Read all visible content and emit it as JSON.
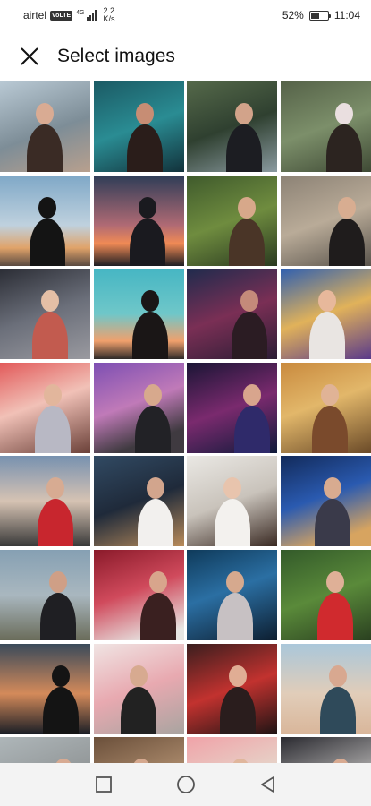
{
  "status_bar": {
    "carrier": "airtel",
    "volte": "VoLTE",
    "network": "4G",
    "speed_value": "2.2",
    "speed_unit": "K/s",
    "battery_text": "52%",
    "battery_level": 0.52,
    "time": "11:04"
  },
  "header": {
    "close_icon": "close-icon",
    "title": "Select images"
  },
  "gallery": {
    "images": [
      {
        "bg": "linear-gradient(160deg,#b9c9d4,#7d8d97 55%,#b8a08e)",
        "fig": "#3a2b25",
        "head": "#d9ab93"
      },
      {
        "bg": "linear-gradient(160deg,#1b5a64,#2a8c93 50%,#12323b)",
        "fig": "#2a1d1a",
        "head": "#c78d74"
      },
      {
        "bg": "linear-gradient(160deg,#55694a,#2f4030 50%,#8a9aa0)",
        "fig": "#1c1d22",
        "head": "#d2a38a"
      },
      {
        "bg": "linear-gradient(160deg,#556248,#7c8f6a 50%,#3f4a35)",
        "fig": "#2c2420",
        "head": "#eadfe0"
      },
      {
        "bg": "linear-gradient(180deg,#7fa8c7,#bfd1de 55%,#e0a36a 80%,#5a4a40)",
        "fig": "#141414",
        "head": "#141414"
      },
      {
        "bg": "linear-gradient(180deg,#2f3d57,#b06a74 55%,#f08a55 75%,#1e1e22)",
        "fig": "#1a1a1f",
        "head": "#1a1a1f"
      },
      {
        "bg": "linear-gradient(160deg,#3f5a2c,#6f8c3f 50%,#2a3a20)",
        "fig": "#4a3527",
        "head": "#d7a88a"
      },
      {
        "bg": "linear-gradient(160deg,#8c8275,#b9ab98 50%,#5a544c)",
        "fig": "#1f1c1c",
        "head": "#d8ad91"
      },
      {
        "bg": "linear-gradient(160deg,#2b2d35,#6b6f7a 50%,#9a9aa0)",
        "fig": "#c25b4f",
        "head": "#e4bfa6"
      },
      {
        "bg": "linear-gradient(180deg,#46b6c3,#6fc7c9 50%,#f0a06c 80%,#2e2a28)",
        "fig": "#1a1616",
        "head": "#1a1616"
      },
      {
        "bg": "linear-gradient(160deg,#1f2b4d,#7a2f55 50%,#2b1d35)",
        "fig": "#2b1c23",
        "head": "#c48a7a"
      },
      {
        "bg": "linear-gradient(160deg,#2f5fb0,#e1b25a 50%,#5a3a8a)",
        "fig": "#e9e5e2",
        "head": "#e7b89b"
      },
      {
        "bg": "linear-gradient(160deg,#e25a5a,#f1c1b7 45%,#6a4038)",
        "fig": "#b8b8c4",
        "head": "#e2b69c"
      },
      {
        "bg": "linear-gradient(160deg,#7d4fb3,#c07ab8 45%,#3f3a40 80%)",
        "fig": "#222226",
        "head": "#d7a98d"
      },
      {
        "bg": "linear-gradient(160deg,#1a1535,#7a2a6e 50%,#0f1a3a)",
        "fig": "#2f2a6a",
        "head": "#d8a58d"
      },
      {
        "bg": "linear-gradient(160deg,#c98a3e,#e2b76a 45%,#6a4a28)",
        "fig": "#7a4a2c",
        "head": "#e0b396"
      },
      {
        "bg": "linear-gradient(180deg,#7791b0,#d6c3b3 50%,#3a3a3a)",
        "fig": "#c8262e",
        "head": "#d7ab92"
      },
      {
        "bg": "linear-gradient(160deg,#314a63,#1f2a3a 50%,#b98b5a)",
        "fig": "#f2f0ee",
        "head": "#d2a58d"
      },
      {
        "bg": "linear-gradient(160deg,#eae8e4,#c9c3bb 50%,#3a2a23)",
        "fig": "#f3f1ee",
        "head": "#e8c4ad"
      },
      {
        "bg": "linear-gradient(160deg,#122a5a,#2a5ab0 45%,#d7a460 85%)",
        "fig": "#3a3a4a",
        "head": "#d8ab90"
      },
      {
        "bg": "linear-gradient(180deg,#86a0b3,#a9b7bf 50%,#6a6c5a)",
        "fig": "#1f1f23",
        "head": "#cf9f86"
      },
      {
        "bg": "linear-gradient(160deg,#8a1a2a,#d04a5c 45%,#e7e6e3 90%)",
        "fig": "#3a2020",
        "head": "#d8a58c"
      },
      {
        "bg": "linear-gradient(160deg,#0f3a5a,#2b6fa3 45%,#0d1e30)",
        "fig": "#c7c1c3",
        "head": "#d6a98e"
      },
      {
        "bg": "linear-gradient(160deg,#335a2a,#5a8a3a 50%,#2a4020)",
        "fig": "#d02a2e",
        "head": "#dfb097"
      },
      {
        "bg": "linear-gradient(180deg,#3a4a5a,#d48a5a 55%,#1a1e26)",
        "fig": "#141414",
        "head": "#141414"
      },
      {
        "bg": "linear-gradient(160deg,#f0e4e3,#e8a9b0 50%,#a8a4a0)",
        "fig": "#222222",
        "head": "#d7aa90"
      },
      {
        "bg": "linear-gradient(160deg,#3a1e1e,#c2322f 50%,#1e1414)",
        "fig": "#2a1d1d",
        "head": "#e0ad94"
      },
      {
        "bg": "linear-gradient(180deg,#aac7da,#e1cdb9 55%,#d9b69a)",
        "fig": "#2f4a5a",
        "head": "#d8a890"
      },
      {
        "bg": "linear-gradient(160deg,#aeb6b9,#8d9192 60%)",
        "fig": "#3a2a22",
        "head": "#d7aa92"
      },
      {
        "bg": "linear-gradient(160deg,#6a4f3a,#b69474 60%)",
        "fig": "#1e1e22",
        "head": "#d5a88e"
      },
      {
        "bg": "linear-gradient(160deg,#f0a2a8,#e6d3c8 50%,#d95a5a)",
        "fig": "#c9323a",
        "head": "#e0b69c"
      },
      {
        "bg": "linear-gradient(160deg,#2a2a30,#b9b7b6 60%)",
        "fig": "#1d1d22",
        "head": "#d8aa91"
      }
    ]
  },
  "nav_bar": {
    "recents_icon": "square-icon",
    "home_icon": "circle-icon",
    "back_icon": "triangle-back-icon"
  }
}
